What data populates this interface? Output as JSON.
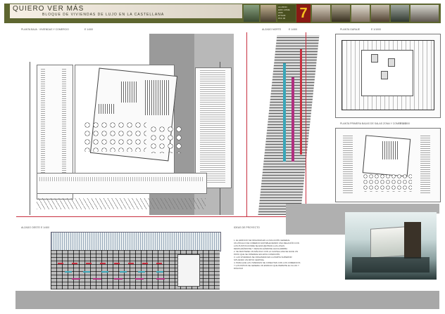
{
  "header": {
    "title": "QUIERO VER MÁS",
    "subtitle": "BLOQUE DE VIVIENDAS DE LUJO EN LA CASTELLANA",
    "sheet_number": "7",
    "info_lines": [
      "ALUMNO",
      "EDIF HOME",
      "2006",
      "ETSAM",
      "PFC 06"
    ]
  },
  "labels": {
    "planta_baja": "PLANTA BAJA · VIVIENDAS Y COMERCIO",
    "scale_main": "E 1/400",
    "alzado_norte": "ALZADO NORTE",
    "scale_norte": "E 1/400",
    "planta_garaje": "PLANTA GARAJE",
    "scale_garaje": "E 1/1000",
    "planta_primera": "PLANTA PRIMERA BAJAS DE SALAS ZONA Y COMERCIO",
    "scale_primera": "E 1/1000",
    "alzado_oeste": "ALZADO OESTE",
    "scale_oeste": "E 1/400",
    "ideas": "IDEAS DE PROYECTO"
  },
  "ideas_text": [
    "1. EL EDIFICIO SE ORGANIZA EN LA SOLUCIÓN GENERAL",
    "UN ZÓCALO DE COMERCIO ESTABLECIENDO UNA RELACIÓN CON LOS PUNTOS DONDE SE ENCUENTRAN LAS LOSAS DESPLAZÁNDOSE Y DESCOLGÁNDOSE HACIA ARRIBA",
    "2. SE MANTIENE UN DIÁLOGO CON LA CASTELLANA SE HACE UN PATIO QUE SE INTERESA EN ESTA CONDICIÓN",
    "3. LAS VIVIENDAS SE ORGANIZAN EN LA PARTE SUPERIOR SITUANDO UN PATIO CENTRAL",
    "4. PARA QUE LAS VIVIENDAS SE CONECTEN CON LOS COMERCIOS Y LOS PATIOS SE GENERA UN ESPACIO QUE PERMITE EL FLUJO Y DIÁLOGO"
  ],
  "colors": {
    "header_bg": "#5e6630",
    "number_bg": "#8a1a14",
    "number_fg": "#f4c020",
    "accent_red": "#c83040",
    "accent_teal": "#3aa6b8",
    "accent_magenta": "#b03080"
  }
}
